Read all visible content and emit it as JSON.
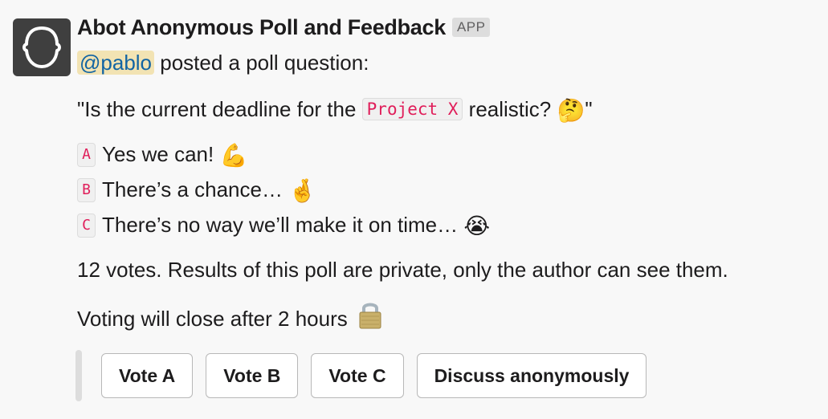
{
  "app": {
    "name": "Abot Anonymous Poll and Feedback",
    "badge": "APP",
    "avatar_icon": "head-outline-icon"
  },
  "post": {
    "mention": "@pablo",
    "intro": " posted a poll question:"
  },
  "question": {
    "prefix": "\"Is the current deadline for the ",
    "code": "Project X",
    "suffix": " realistic? ",
    "emoji": "🤔",
    "close_quote": "\""
  },
  "options": [
    {
      "letter": "A",
      "text": "Yes we can! ",
      "emoji": "💪",
      "emoji_name": "flexed-biceps-icon"
    },
    {
      "letter": "B",
      "text": "There’s a chance… ",
      "emoji": "🤞",
      "emoji_name": "crossed-fingers-icon"
    },
    {
      "letter": "C",
      "text": "There’s no way we’ll make it on time… ",
      "emoji": "😭",
      "emoji_name": "loudly-crying-face-icon"
    }
  ],
  "votes_text": "12 votes. Results of this poll are private, only the author can see them.",
  "closing_text": "Voting will close after 2 hours",
  "closing_icon": "lock-icon",
  "actions": [
    {
      "label": "Vote A"
    },
    {
      "label": "Vote B"
    },
    {
      "label": "Vote C"
    },
    {
      "label": "Discuss anonymously"
    }
  ],
  "colors": {
    "background": "#f8f8f8",
    "mention_bg": "#f2e3b3",
    "mention_text": "#1264a3",
    "code_text": "#e01e5a",
    "avatar_bg": "#3f3f3f"
  }
}
